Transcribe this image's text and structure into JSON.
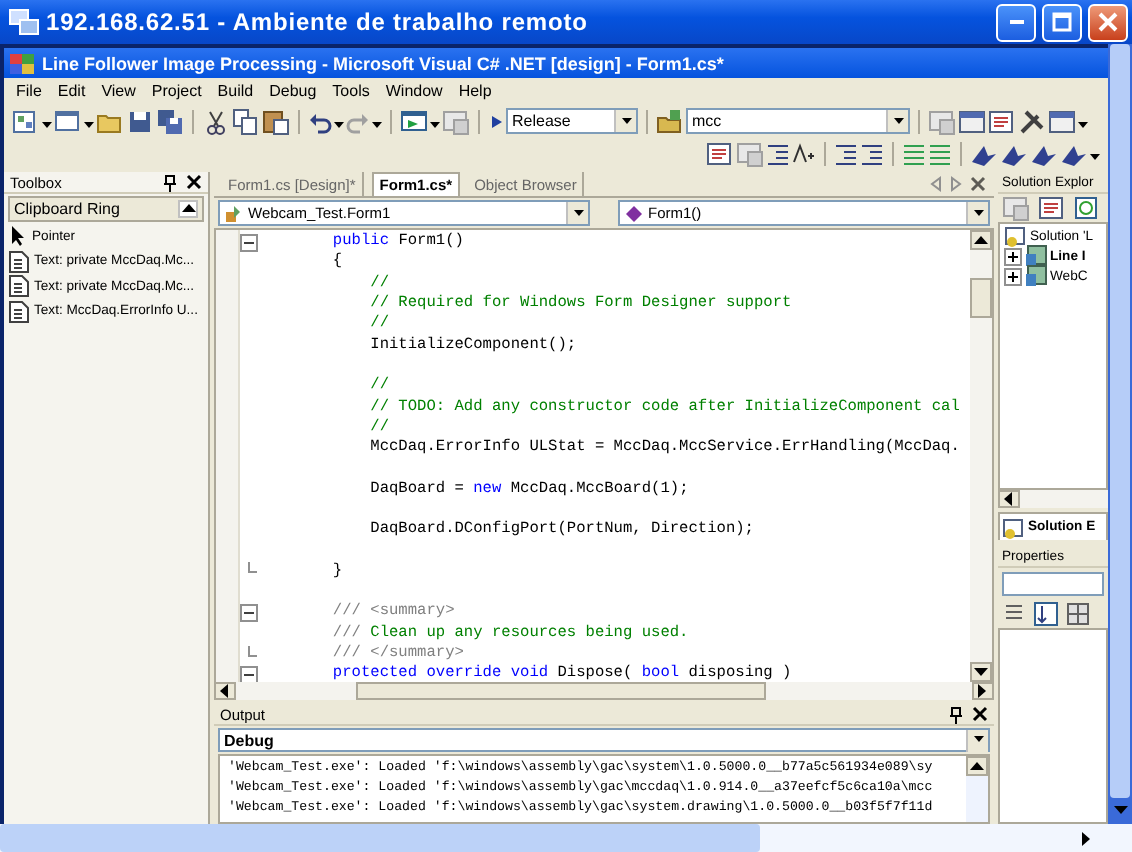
{
  "remote_window": {
    "title": "192.168.62.51 - Ambiente de trabalho remoto"
  },
  "app_window": {
    "title": "Line Follower Image Processing - Microsoft Visual C# .NET [design] - Form1.cs*"
  },
  "menu": [
    "File",
    "Edit",
    "View",
    "Project",
    "Build",
    "Debug",
    "Tools",
    "Window",
    "Help"
  ],
  "toolbar": {
    "configuration": "Release",
    "find_combo": "mcc"
  },
  "toolbox": {
    "title": "Toolbox",
    "tab": "Clipboard Ring",
    "items": [
      {
        "kind": "pointer",
        "label": "Pointer"
      },
      {
        "kind": "text",
        "label": "Text: private MccDaq.Mc..."
      },
      {
        "kind": "text",
        "label": "Text: private MccDaq.Mc..."
      },
      {
        "kind": "text",
        "label": "Text: MccDaq.ErrorInfo U..."
      }
    ]
  },
  "editor": {
    "tabs": [
      {
        "label": "Form1.cs [Design]*",
        "selected": false
      },
      {
        "label": "Form1.cs*",
        "selected": true
      },
      {
        "label": "Object Browser",
        "selected": false
      }
    ],
    "class_combo": "Webcam_Test.Form1",
    "member_combo": "Form1()",
    "lines": [
      {
        "kind": "code",
        "fold_start": true,
        "segments": [
          {
            "kind": "keyword",
            "text": "        public"
          },
          {
            "kind": "plain",
            "text": " Form1()"
          }
        ]
      },
      {
        "kind": "code",
        "segments": [
          {
            "kind": "plain",
            "text": "        {"
          }
        ]
      },
      {
        "kind": "code",
        "segments": [
          {
            "kind": "comment",
            "text": "            //"
          }
        ]
      },
      {
        "kind": "code",
        "segments": [
          {
            "kind": "comment",
            "text": "            // Required for Windows Form Designer support"
          }
        ]
      },
      {
        "kind": "code",
        "segments": [
          {
            "kind": "comment",
            "text": "            //"
          }
        ]
      },
      {
        "kind": "code",
        "segments": [
          {
            "kind": "plain",
            "text": "            InitializeComponent();"
          }
        ]
      },
      {
        "kind": "blank"
      },
      {
        "kind": "code",
        "segments": [
          {
            "kind": "comment",
            "text": "            //"
          }
        ]
      },
      {
        "kind": "code",
        "segments": [
          {
            "kind": "comment",
            "text": "            // TODO: Add any constructor code after InitializeComponent cal"
          }
        ]
      },
      {
        "kind": "code",
        "segments": [
          {
            "kind": "comment",
            "text": "            //"
          }
        ]
      },
      {
        "kind": "code",
        "segments": [
          {
            "kind": "plain",
            "text": "            MccDaq.ErrorInfo ULStat = MccDaq.MccService.ErrHandling(MccDaq."
          }
        ]
      },
      {
        "kind": "blank"
      },
      {
        "kind": "code",
        "segments": [
          {
            "kind": "plain",
            "text": "            DaqBoard = "
          },
          {
            "kind": "keyword",
            "text": "new"
          },
          {
            "kind": "plain",
            "text": " MccDaq.MccBoard(1);"
          }
        ]
      },
      {
        "kind": "blank"
      },
      {
        "kind": "code",
        "segments": [
          {
            "kind": "plain",
            "text": "            DaqBoard.DConfigPort(PortNum, Direction);"
          }
        ]
      },
      {
        "kind": "blank"
      },
      {
        "kind": "code",
        "fold_end": true,
        "segments": [
          {
            "kind": "plain",
            "text": "        }"
          }
        ]
      },
      {
        "kind": "blank"
      },
      {
        "kind": "code",
        "fold_start": true,
        "segments": [
          {
            "kind": "doc",
            "text": "        /// <summary>"
          }
        ]
      },
      {
        "kind": "code",
        "segments": [
          {
            "kind": "doc",
            "text": "        ///"
          },
          {
            "kind": "comment",
            "text": " Clean up any resources being used."
          }
        ]
      },
      {
        "kind": "code",
        "fold_end": true,
        "segments": [
          {
            "kind": "doc",
            "text": "        /// </summary>"
          }
        ]
      },
      {
        "kind": "code",
        "fold_start": true,
        "segments": [
          {
            "kind": "keyword",
            "text": "        protected override void"
          },
          {
            "kind": "plain",
            "text": " Dispose( "
          },
          {
            "kind": "keyword",
            "text": "bool"
          },
          {
            "kind": "plain",
            "text": " disposing )"
          }
        ]
      }
    ]
  },
  "output": {
    "title": "Output",
    "pane": "Debug",
    "lines": [
      "'Webcam_Test.exe': Loaded 'f:\\windows\\assembly\\gac\\system\\1.0.5000.0__b77a5c561934e089\\sy",
      "'Webcam_Test.exe': Loaded 'f:\\windows\\assembly\\gac\\mccdaq\\1.0.914.0__a37eefcf5c6ca10a\\mcc",
      "'Webcam_Test.exe': Loaded 'f:\\windows\\assembly\\gac\\system.drawing\\1.0.5000.0__b03f5f7f11d"
    ]
  },
  "solution_explorer": {
    "title": "Solution Explor",
    "tree": [
      {
        "label": "Solution 'L",
        "children": [
          {
            "label": "Line I",
            "startup": true,
            "expanded": false
          },
          {
            "label": "WebC",
            "startup": false,
            "expanded": false
          }
        ]
      }
    ],
    "tab": "Solution E"
  },
  "properties": {
    "title": "Properties"
  }
}
